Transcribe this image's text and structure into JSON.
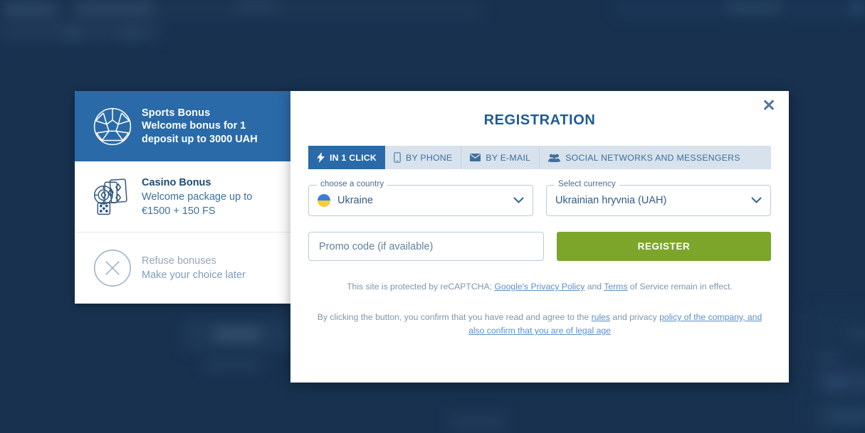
{
  "bonus_panel": {
    "items": [
      {
        "icon": "soccer-ball-icon",
        "title": "Sports Bonus",
        "description": "Welcome bonus for 1 deposit up to 3000 UAH",
        "selected": true
      },
      {
        "icon": "casino-chips-cards-icon",
        "title": "Casino Bonus",
        "description": "Welcome package up to €1500 + 150 FS",
        "selected": false
      },
      {
        "icon": "circle-x-icon",
        "title": "Refuse bonuses",
        "description": "Make your choice later",
        "selected": false
      }
    ]
  },
  "modal": {
    "title": "REGISTRATION",
    "close_label": "✕",
    "tabs": [
      {
        "label": "IN 1 CLICK",
        "icon": "lightning-bolt-icon",
        "active": true
      },
      {
        "label": "BY PHONE",
        "icon": "mobile-phone-icon",
        "active": false
      },
      {
        "label": "BY E-MAIL",
        "icon": "envelope-icon",
        "active": false
      },
      {
        "label": "SOCIAL NETWORKS AND MESSENGERS",
        "icon": "users-group-icon",
        "active": false
      }
    ],
    "country_field": {
      "legend": "choose a country",
      "value": "Ukraine",
      "flag": "ukraine-flag-icon",
      "chevron": "chevron-down-icon"
    },
    "currency_field": {
      "legend": "Select currency",
      "value": "Ukrainian hryvnia (UAH)",
      "chevron": "chevron-down-icon"
    },
    "promo_field": {
      "placeholder": "Promo code (if available)",
      "value": ""
    },
    "register_button": "REGISTER",
    "legal": {
      "recaptcha_pre": "This site is protected by reCAPTCHA; ",
      "recaptcha_link1": "Google's Privacy Policy",
      "recaptcha_mid": " and ",
      "recaptcha_link2": "Terms",
      "recaptcha_post": " of Service remain in effect.",
      "terms_pre": "By clicking the button, you confirm that you have read and agree to the ",
      "terms_link1": "rules",
      "terms_mid": " and privacy ",
      "terms_link2": "policy of the company, and also confirm that you are of legal age"
    }
  },
  "colors": {
    "backdrop": "#17314f",
    "accent_blue": "#2a6aa8",
    "title_blue": "#1f5b96",
    "register_green": "#7ba62a",
    "tab_inactive_bg": "#d7e2ec",
    "link_blue": "#5b8fc9"
  }
}
